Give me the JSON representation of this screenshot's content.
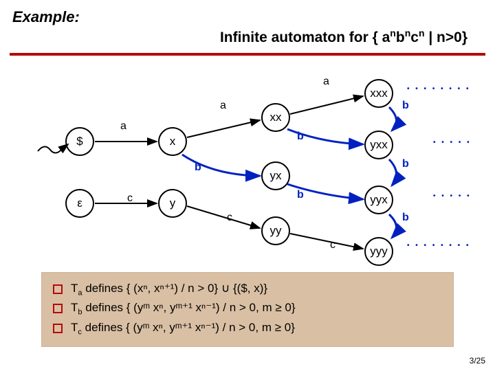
{
  "title": {
    "example": "Example:",
    "heading_pre": "Infinite automaton for { a",
    "heading_post": " | n>0}"
  },
  "footer": "3/25",
  "nodes": {
    "dollar": "$",
    "eps": "ε",
    "x": "x",
    "y": "y",
    "xx": "xx",
    "yx": "yx",
    "yy": "yy",
    "xxx": "xxx",
    "yxx": "yxx",
    "yyx": "yyx",
    "yyy": "yyy"
  },
  "labels": {
    "a": "a",
    "b": "b",
    "c": "c"
  },
  "defs": {
    "Ta": {
      "name": "T",
      "sub": "a",
      "rest": " defines { (xⁿ, xⁿ⁺¹) / n > 0} ∪ {($, x)}"
    },
    "Tb": {
      "name": "T",
      "sub": "b",
      "rest": " defines { (yᵐ xⁿ, yᵐ⁺¹ xⁿ⁻¹) / n > 0, m ≥ 0}"
    },
    "Tc": {
      "name": "T",
      "sub": "c",
      "rest": " defines { (yᵐ xⁿ, yᵐ⁺¹ xⁿ⁻¹) / n > 0, m ≥ 0}"
    }
  }
}
